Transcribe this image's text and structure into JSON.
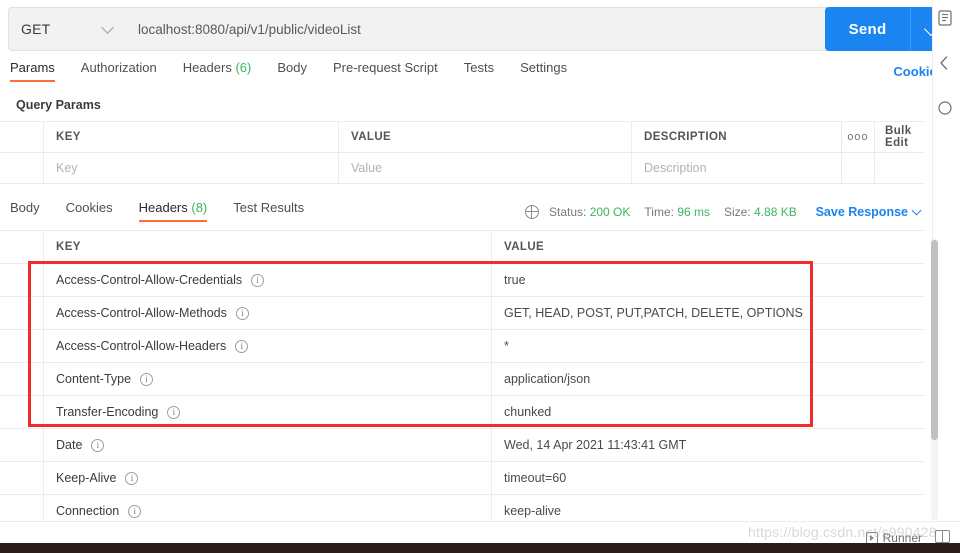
{
  "request": {
    "method": "GET",
    "method_icon": "chevron-down-icon",
    "url": "localhost:8080/api/v1/public/videoList",
    "send_label": "Send",
    "send_caret_icon": "chevron-down-icon"
  },
  "request_tabs": [
    {
      "label": "Params",
      "active": true
    },
    {
      "label": "Authorization",
      "active": false
    },
    {
      "label": "Headers",
      "count": "(6)",
      "active": false
    },
    {
      "label": "Body",
      "active": false
    },
    {
      "label": "Pre-request Script",
      "active": false
    },
    {
      "label": "Tests",
      "active": false
    },
    {
      "label": "Settings",
      "active": false
    }
  ],
  "cookies_link": "Cookies",
  "query_params": {
    "title": "Query Params",
    "headers": {
      "key": "KEY",
      "value": "VALUE",
      "description": "DESCRIPTION"
    },
    "dots_icon": "ooo",
    "bulk_edit": "Bulk Edit",
    "empty_row": {
      "key": "Key",
      "value": "Value",
      "description": "Description"
    }
  },
  "response_tabs": [
    {
      "label": "Body",
      "active": false
    },
    {
      "label": "Cookies",
      "active": false
    },
    {
      "label": "Headers",
      "count": "(8)",
      "active": true
    },
    {
      "label": "Test Results",
      "active": false
    }
  ],
  "response_stats": {
    "globe_icon": "globe-icon",
    "status_label": "Status:",
    "status_value": "200 OK",
    "time_label": "Time:",
    "time_value": "96 ms",
    "size_label": "Size:",
    "size_value": "4.88 KB",
    "save_response": "Save Response",
    "save_caret_icon": "chevron-down-icon"
  },
  "response_headers": {
    "columns": {
      "key": "KEY",
      "value": "VALUE"
    },
    "info_icon": "info-icon",
    "rows": [
      {
        "key": "Access-Control-Allow-Credentials",
        "value": "true",
        "highlighted": true
      },
      {
        "key": "Access-Control-Allow-Methods",
        "value": "GET, HEAD, POST, PUT,PATCH, DELETE, OPTIONS",
        "highlighted": true
      },
      {
        "key": "Access-Control-Allow-Headers",
        "value": "*",
        "highlighted": true
      },
      {
        "key": "Content-Type",
        "value": "application/json",
        "highlighted": true
      },
      {
        "key": "Transfer-Encoding",
        "value": "chunked",
        "highlighted": true
      },
      {
        "key": "Date",
        "value": "Wed, 14 Apr 2021 11:43:41 GMT",
        "highlighted": false
      },
      {
        "key": "Keep-Alive",
        "value": "timeout=60",
        "highlighted": false
      },
      {
        "key": "Connection",
        "value": "keep-alive",
        "highlighted": false
      }
    ]
  },
  "annotation": {
    "highlight_color": "#f42b2b"
  },
  "right_rail": [
    {
      "icon": "code-snippet-icon"
    },
    {
      "icon": "comment-icon"
    },
    {
      "icon": "info-circle-icon"
    }
  ],
  "footer": {
    "watermark": "https://blog.csdn.net/s990428",
    "runner_label": "Runner",
    "runner_icon": "play-box-icon",
    "layout_icon": "two-pane-layout-icon"
  },
  "colors": {
    "accent": "#ff6c37",
    "link": "#1a84f0",
    "success": "#3bb55e"
  }
}
